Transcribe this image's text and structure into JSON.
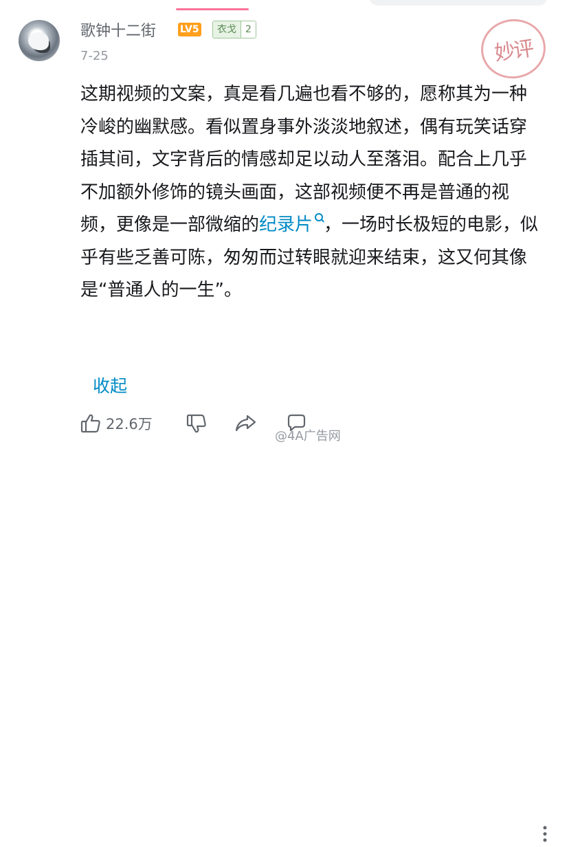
{
  "comment": {
    "username": "歌钟十二街",
    "level_badge": "LV5",
    "medal": {
      "name": "衣戈",
      "level": "2"
    },
    "date": "7-25",
    "stamp_text": "妙评",
    "paragraph_before_link": "这期视频的文案，真是看几遍也看不够的，愿称其为一种冷峻的幽默感。看似置身事外淡淡地叙述，偶有玩笑话穿插其间，文字背后的情感却足以动人至落泪。配合上几乎不加额外修饰的镜头画面，这部视频便不再是普通的视频，更像是一部微缩的",
    "link_text": "纪录片",
    "paragraph_after_link": "，一场时长极短的电影，似乎有些乏善可陈，匆匆而过转眼就迎来结束，这又何其像是“普通人的一生”。",
    "collapse_label": "收起"
  },
  "actions": {
    "like_count": "22.6万",
    "watermark": "@4A广告网"
  },
  "colors": {
    "accent_link": "#008ac5",
    "tab_indicator": "#fb7299",
    "level_badge": "#ff9f1c",
    "stamp": "#d98a8e"
  },
  "icons": [
    "avatar",
    "thumbs-up-icon",
    "thumbs-down-icon",
    "share-icon",
    "reply-icon",
    "more-icon",
    "search-icon"
  ]
}
